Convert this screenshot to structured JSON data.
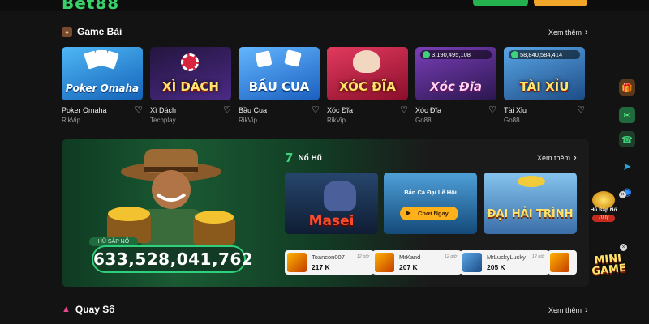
{
  "header": {
    "logo_text": "Bet88"
  },
  "game_bai": {
    "title": "Game Bài",
    "see_more": "Xem thêm",
    "cards": [
      {
        "name": "Poker Omaha",
        "provider": "RikVip",
        "art_text": "Poker Omaha",
        "bg": "#1e7fd1",
        "jackpot": ""
      },
      {
        "name": "Xì Dách",
        "provider": "Techplay",
        "art_text": "XÌ DÁCH",
        "bg": "#3a1e63",
        "jackpot": ""
      },
      {
        "name": "Bầu Cua",
        "provider": "RikVip",
        "art_text": "BẦU CUA",
        "bg": "#1c6fd0",
        "jackpot": ""
      },
      {
        "name": "Xóc Đĩa",
        "provider": "RikVip",
        "art_text": "XÓC ĐĨA",
        "bg": "#b0133a",
        "jackpot": ""
      },
      {
        "name": "Xóc Đĩa",
        "provider": "Go88",
        "art_text": "Xóc Đĩa",
        "bg": "#5a2a8a",
        "jackpot": "3,190,495,108"
      },
      {
        "name": "Tài Xỉu",
        "provider": "Go88",
        "art_text": "TÀI XỈU",
        "bg": "#2b6aa8",
        "jackpot": "58,840,584,414"
      }
    ]
  },
  "no_hu": {
    "title": "Nổ Hũ",
    "see_more": "Xem thêm",
    "jackpot_label": "HŨ SẮP NỔ",
    "jackpot_value": "633,528,041,762",
    "slots": [
      {
        "title": "Masei",
        "bg": "#1d3b5c"
      },
      {
        "title": "Bắn Cá Đại Lễ Hội",
        "button": "Chơi Ngay",
        "bg": "#1f5f86"
      },
      {
        "title": "ĐẠI HẢI TRÌNH",
        "bg": "#3e7fb5"
      }
    ],
    "winners": [
      {
        "user": "Toancon007",
        "time": "12 giờ",
        "amount": "217 K"
      },
      {
        "user": "MrKand",
        "time": "12 giờ",
        "amount": "207 K"
      },
      {
        "user": "MrLuckyLucky",
        "time": "12 giờ",
        "amount": "205 K"
      }
    ]
  },
  "quay_so": {
    "title": "Quay Số",
    "see_more": "Xem thêm"
  },
  "floating": {
    "hu_label": "Hũ Sắp Nổ",
    "hu_value": "70 tỷ",
    "minigame_text": "MINI GAME"
  }
}
